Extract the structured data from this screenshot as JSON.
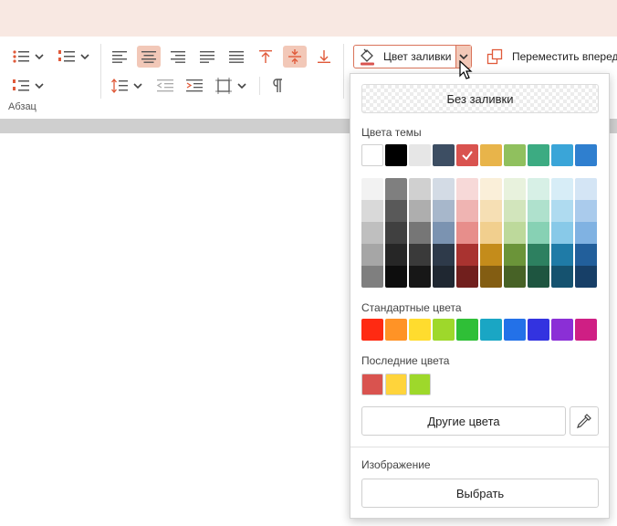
{
  "ribbon": {
    "group_label": "Абзац",
    "fill_button": {
      "label": "Цвет заливки",
      "underline_color": "#d9534f"
    },
    "move_forward_label": "Переместить вперед"
  },
  "popup": {
    "no_fill_label": "Без заливки",
    "theme_title": "Цвета темы",
    "theme_colors": [
      "#ffffff",
      "#000000",
      "#e6e6e6",
      "#3d4e63",
      "#d9534f",
      "#e8b44a",
      "#90c05e",
      "#3cab82",
      "#3aa5d8",
      "#2f7fcf"
    ],
    "theme_selected_index": 4,
    "theme_shades": [
      [
        "#f2f2f2",
        "#d9d9d9",
        "#bfbfbf",
        "#a6a6a6",
        "#7f7f7f"
      ],
      [
        "#7f7f7f",
        "#595959",
        "#404040",
        "#262626",
        "#0d0d0d"
      ],
      [
        "#d0d0d0",
        "#aeaeae",
        "#767676",
        "#3a3a3a",
        "#171717"
      ],
      [
        "#d3dbe5",
        "#a7b7cb",
        "#7b93b1",
        "#2e3a4a",
        "#1f2731"
      ],
      [
        "#f7d9d8",
        "#efb4b2",
        "#e78e8b",
        "#a93330",
        "#711f1d"
      ],
      [
        "#faefd9",
        "#f6dfb4",
        "#f1cf8e",
        "#c48c1b",
        "#835d12"
      ],
      [
        "#e8f2dd",
        "#d2e5bc",
        "#bdd99b",
        "#6b9439",
        "#476226"
      ],
      [
        "#d7f0e6",
        "#afe1cd",
        "#87d1b4",
        "#2d8060",
        "#1e5540"
      ],
      [
        "#d7edf7",
        "#afdbf0",
        "#88c9e8",
        "#1f7ba7",
        "#15526f"
      ],
      [
        "#d4e5f5",
        "#aacbec",
        "#80b2e2",
        "#225f9b",
        "#173f67"
      ]
    ],
    "standard_title": "Стандартные цвета",
    "standard_colors": [
      "#ff2a12",
      "#ff9326",
      "#ffdc2e",
      "#9ed82b",
      "#2fbf37",
      "#1aa6c4",
      "#2371e8",
      "#3333e0",
      "#8b2fd6",
      "#cf1f84"
    ],
    "recent_title": "Последние цвета",
    "recent_colors": [
      "#d9534f",
      "#ffd43b",
      "#9ed82b"
    ],
    "other_colors_label": "Другие цвета",
    "image_title": "Изображение",
    "choose_label": "Выбрать"
  }
}
